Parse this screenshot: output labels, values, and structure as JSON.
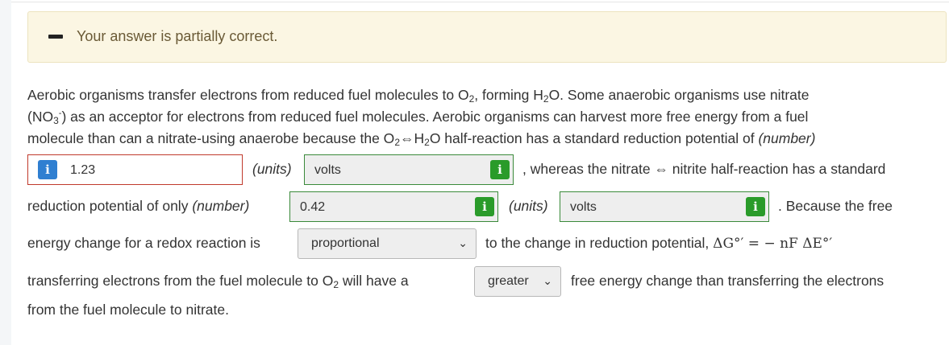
{
  "banner": {
    "message": "Your answer is partially correct."
  },
  "question": {
    "p1_a": "Aerobic organisms transfer electrons from reduced fuel molecules to O",
    "p1_sub2": "2",
    "p1_b": ", forming H",
    "p1_sub2b": "2",
    "p1_c": "O. Some anaerobic organisms use nitrate",
    "p2_a": "(NO",
    "p2_sub": "3",
    "p2_sup": "-",
    "p2_b": ") as an acceptor for electrons from reduced fuel molecules. Aerobic organisms can harvest more free energy from a fuel",
    "p3_a": "molecule than can a nitrate-using anaerobe because the O",
    "p3_sub": "2",
    "p3_b": "⇔H",
    "p3_sub2": "2",
    "p3_c": "O half-reaction has a standard reduction potential of",
    "p3_label": "(number)",
    "units_label": "(units)",
    "number_label": "(number)",
    "after_volts1": ", whereas the nitrate ⇔ nitrite half-reaction has a standard",
    "line5_a": "reduction potential of only",
    "after_volts2": ". Because the free",
    "line6_a": "energy change for a redox reaction is",
    "line6_b": "to the change in reduction potential,",
    "equation": "ΔG°′ = − nF ΔE°′",
    "line7_a": "transferring electrons from the fuel molecule to O",
    "line7_sub": "2",
    "line7_b": " will have a",
    "line7_c": "free energy change than transferring the electrons",
    "line8": "from the fuel molecule to nitrate."
  },
  "inputs": {
    "o2_number": "1.23",
    "o2_units": "volts",
    "nitrate_number": "0.42",
    "nitrate_units": "volts"
  },
  "selects": {
    "relation": "proportional",
    "comparison": "greater"
  },
  "icons": {
    "info": "i",
    "chevron": "⌄"
  }
}
